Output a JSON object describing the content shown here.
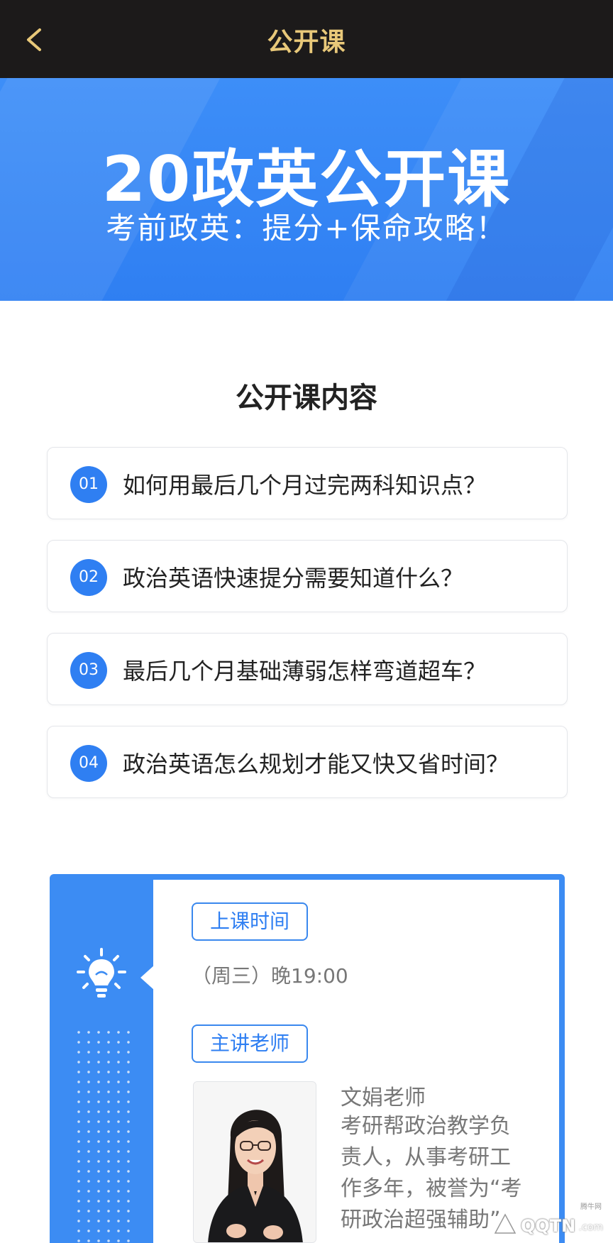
{
  "header": {
    "title": "公开课",
    "back_icon": "chevron-left-icon",
    "bg_color": "#1c1a1a",
    "title_color": "#e8c879"
  },
  "banner": {
    "title": "20政英公开课",
    "subtitle": "考前政英：提分+保命攻略！",
    "bg_color": "#2f7ff2"
  },
  "content_section": {
    "title": "公开课内容",
    "topics": [
      {
        "num": "01",
        "text": "如何用最后几个月过完两科知识点？"
      },
      {
        "num": "02",
        "text": "政治英语快速提分需要知道什么？"
      },
      {
        "num": "03",
        "text": "最后几个月基础薄弱怎样弯道超车？"
      },
      {
        "num": "04",
        "text": "政治英语怎么规划才能又快又省时间？"
      }
    ]
  },
  "info": {
    "icon": "lightbulb-icon",
    "time_label": "上课时间",
    "time_value": "（周三）晚19:00",
    "teacher_label": "主讲老师",
    "teacher_name": "文娟老师",
    "teacher_desc": "考研帮政治教学负责人，从事考研工作多年，被誉为“考研政治超强辅助”。"
  },
  "watermark": {
    "text": "QQTN",
    "suffix": ".com",
    "small": "腾牛网"
  },
  "accent_color": "#2f7ff2"
}
